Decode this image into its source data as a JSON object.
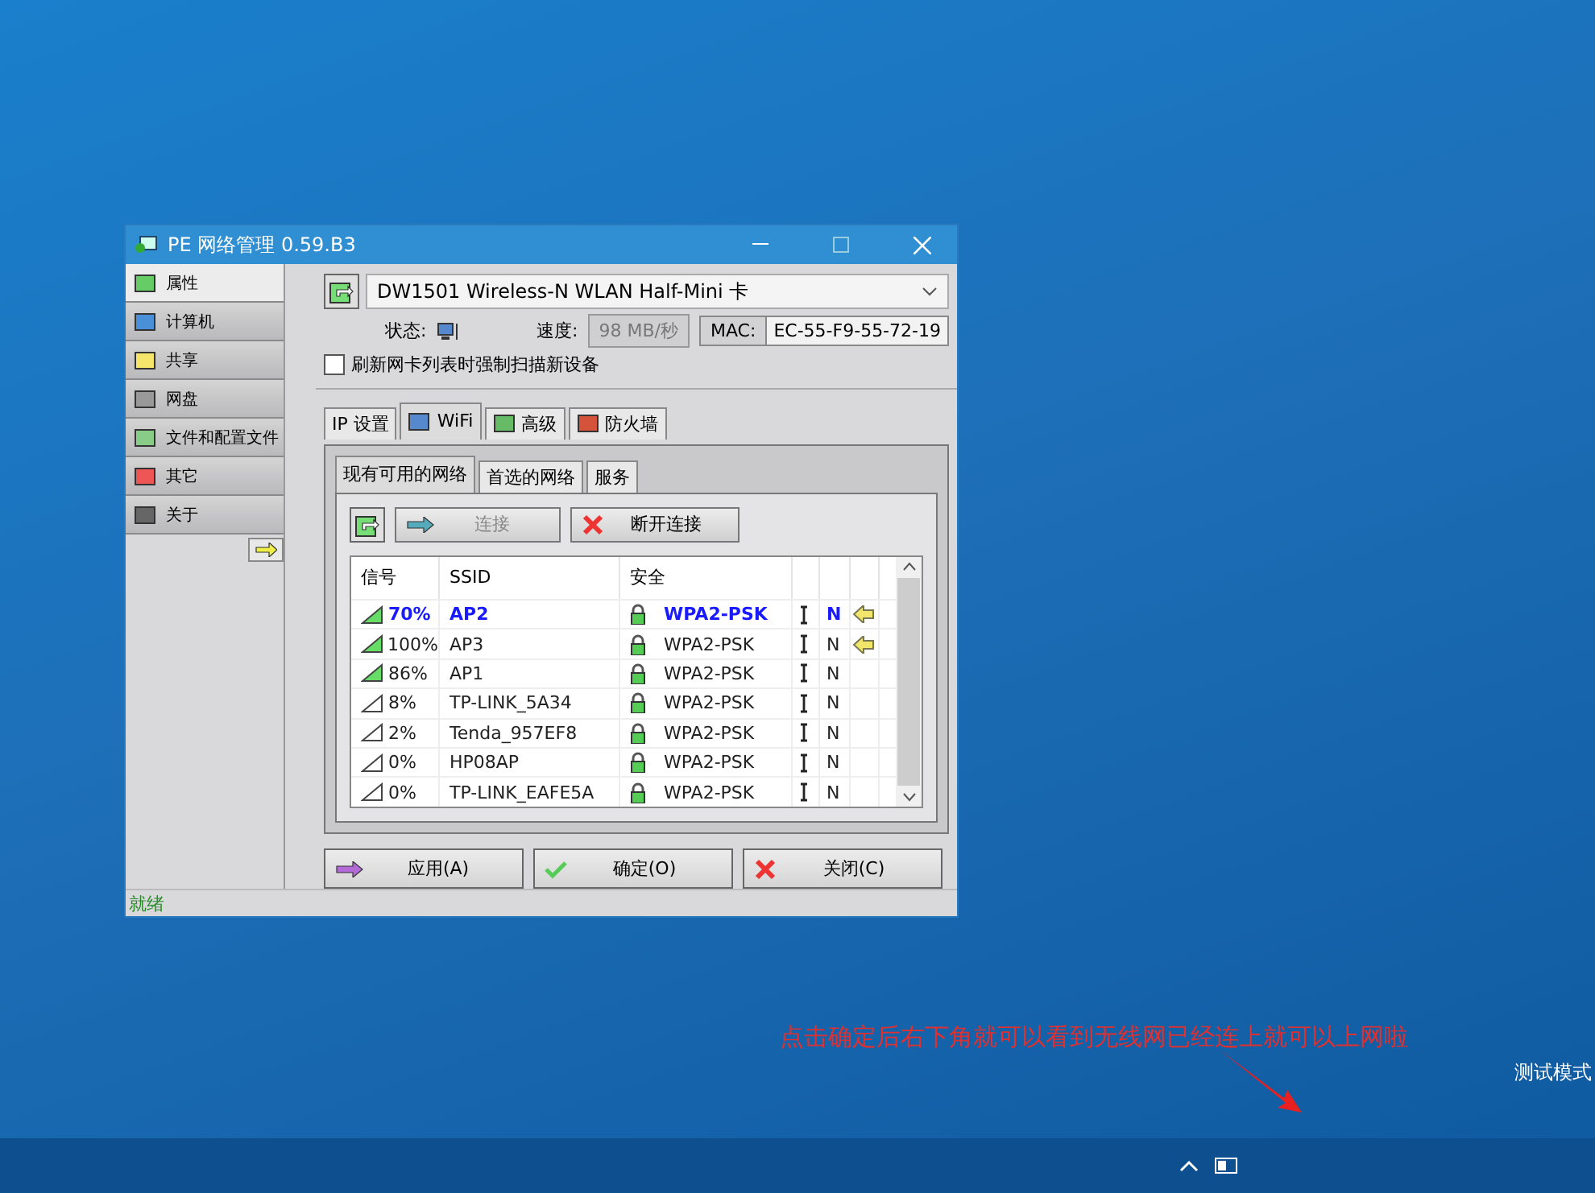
{
  "window": {
    "title": "PE 网络管理 0.59.B3"
  },
  "sidebar": {
    "items": [
      {
        "label": "属性",
        "selected": true
      },
      {
        "label": "计算机",
        "selected": false
      },
      {
        "label": "共享",
        "selected": false
      },
      {
        "label": "网盘",
        "selected": false
      },
      {
        "label": "文件和配置文件",
        "selected": false
      },
      {
        "label": "其它",
        "selected": false
      },
      {
        "label": "关于",
        "selected": false
      }
    ]
  },
  "adapter": {
    "name": "DW1501 Wireless-N WLAN Half-Mini 卡"
  },
  "status_label": "状态:",
  "speed_label": "速度:",
  "speed": "98 MB/秒",
  "mac_label": "MAC:",
  "mac": "EC-55-F9-55-72-19",
  "rescan": {
    "label": "刷新网卡列表时强制扫描新设备",
    "checked": false
  },
  "tabs": [
    {
      "label": "IP 设置",
      "selected": false
    },
    {
      "label": "WiFi",
      "selected": true
    },
    {
      "label": "高级",
      "selected": false
    },
    {
      "label": "防火墙",
      "selected": false
    }
  ],
  "subtabs": [
    {
      "label": "现有可用的网络",
      "selected": true
    },
    {
      "label": "首选的网络",
      "selected": false
    },
    {
      "label": "服务",
      "selected": false
    }
  ],
  "actions": [
    {
      "label": "连接",
      "disabled": true
    },
    {
      "label": "断开连接",
      "disabled": false
    }
  ],
  "table": {
    "columns": [
      "信号",
      "SSID",
      "安全"
    ],
    "rows": [
      {
        "signal": "70%",
        "kind": "strong",
        "ssid": "AP2",
        "security": "WPA2-PSK",
        "mode": "N",
        "selected": true,
        "connected": true
      },
      {
        "signal": "100%",
        "kind": "strong",
        "ssid": "AP3",
        "security": "WPA2-PSK",
        "mode": "N",
        "selected": false,
        "connected": true
      },
      {
        "signal": "86%",
        "kind": "strong",
        "ssid": "AP1",
        "security": "WPA2-PSK",
        "mode": "N",
        "selected": false,
        "connected": false
      },
      {
        "signal": "8%",
        "kind": "weak",
        "ssid": "TP-LINK_5A34",
        "security": "WPA2-PSK",
        "mode": "N",
        "selected": false,
        "connected": false
      },
      {
        "signal": "2%",
        "kind": "weak",
        "ssid": "Tenda_957EF8",
        "security": "WPA2-PSK",
        "mode": "N",
        "selected": false,
        "connected": false
      },
      {
        "signal": "0%",
        "kind": "weak",
        "ssid": "HP08AP",
        "security": "WPA2-PSK",
        "mode": "N",
        "selected": false,
        "connected": false
      },
      {
        "signal": "0%",
        "kind": "weak",
        "ssid": "TP-LINK_EAFE5A",
        "security": "WPA2-PSK",
        "mode": "N",
        "selected": false,
        "connected": false
      }
    ]
  },
  "footer_buttons": [
    {
      "label": "应用(A)",
      "kind": "apply"
    },
    {
      "label": "确定(O)",
      "kind": "ok"
    },
    {
      "label": "关闭(C)",
      "kind": "close"
    }
  ],
  "status_bar": "就绪",
  "annotation": "点击确定后右下角就可以看到无线网已经连上就可以上网啦",
  "desktop_text": "测试模式"
}
